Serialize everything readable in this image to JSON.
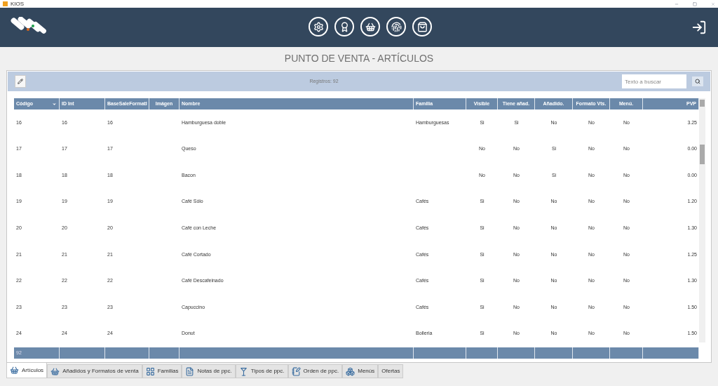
{
  "window": {
    "title": "KIOS"
  },
  "page_title": "PUNTO DE VENTA - ARTÍCULOS",
  "toolbar": {
    "records": "Registros: 92",
    "search": {
      "placeholder": "Texto a buscar"
    }
  },
  "table": {
    "columns": [
      {
        "label": "Código",
        "sorted": true
      },
      {
        "label": "ID Int",
        "sorted": false
      },
      {
        "label": "BaseSaleFormatI",
        "sorted": false
      },
      {
        "label": "Imágen",
        "sorted": false
      },
      {
        "label": "Nombre",
        "sorted": false
      },
      {
        "label": "Familia",
        "sorted": false
      },
      {
        "label": "Visible",
        "sorted": false
      },
      {
        "label": "Tiene añad.",
        "sorted": false
      },
      {
        "label": "Añadido.",
        "sorted": false
      },
      {
        "label": "Formato Vts.",
        "sorted": false
      },
      {
        "label": "Menú.",
        "sorted": false
      },
      {
        "label": "PVP",
        "sorted": false
      }
    ],
    "rows": [
      [
        "16",
        "16",
        "16",
        "",
        "Hamburguesa doble",
        "Hamburguesas",
        "Si",
        "Si",
        "No",
        "No",
        "No",
        "3.25"
      ],
      [
        "17",
        "17",
        "17",
        "",
        "Queso",
        "",
        "No",
        "No",
        "Si",
        "No",
        "No",
        "0.00"
      ],
      [
        "18",
        "18",
        "18",
        "",
        "Bacon",
        "",
        "No",
        "No",
        "Si",
        "No",
        "No",
        "0.00"
      ],
      [
        "19",
        "19",
        "19",
        "",
        "Café Sólo",
        "Cafés",
        "Si",
        "No",
        "No",
        "No",
        "No",
        "1.20"
      ],
      [
        "20",
        "20",
        "20",
        "",
        "Café con Leche",
        "Cafés",
        "Si",
        "No",
        "No",
        "No",
        "No",
        "1.30"
      ],
      [
        "21",
        "21",
        "21",
        "",
        "Café Cortado",
        "Cafés",
        "Si",
        "No",
        "No",
        "No",
        "No",
        "1.25"
      ],
      [
        "22",
        "22",
        "22",
        "",
        "Café Descafeinado",
        "Cafés",
        "Si",
        "No",
        "No",
        "No",
        "No",
        "1.30"
      ],
      [
        "23",
        "23",
        "23",
        "",
        "Capuccino",
        "Cafés",
        "Si",
        "No",
        "No",
        "No",
        "No",
        "1.50"
      ],
      [
        "24",
        "24",
        "24",
        "",
        "Donut",
        "Bolleria",
        "Si",
        "No",
        "No",
        "No",
        "No",
        "1.50"
      ]
    ],
    "footer": "92"
  },
  "tabs": [
    {
      "label": "Artículos",
      "selected": true
    },
    {
      "label": "Añadidos y Formatos de venta",
      "selected": false
    },
    {
      "label": "Familias",
      "selected": false
    },
    {
      "label": "Notas de ppc.",
      "selected": false
    },
    {
      "label": "Tipos de ppc.",
      "selected": false
    },
    {
      "label": "Orden de ppc.",
      "selected": false
    },
    {
      "label": "Menús",
      "selected": false
    },
    {
      "label": "Ofertas",
      "selected": false
    }
  ]
}
